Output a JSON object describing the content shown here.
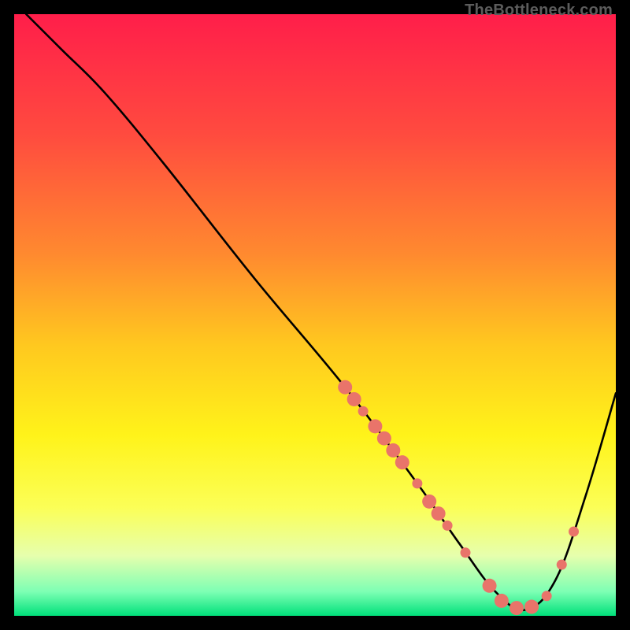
{
  "watermark": "TheBottleneck.com",
  "chart_data": {
    "type": "line",
    "title": "",
    "xlabel": "",
    "ylabel": "",
    "xlim": [
      0,
      100
    ],
    "ylim": [
      0,
      100
    ],
    "grid": false,
    "legend": false,
    "background_gradient": {
      "stops": [
        {
          "pos": 0.0,
          "color": "#ff1e4a"
        },
        {
          "pos": 0.2,
          "color": "#ff4b3f"
        },
        {
          "pos": 0.4,
          "color": "#ff8a2f"
        },
        {
          "pos": 0.55,
          "color": "#ffc81f"
        },
        {
          "pos": 0.7,
          "color": "#fff31a"
        },
        {
          "pos": 0.82,
          "color": "#fbff57"
        },
        {
          "pos": 0.9,
          "color": "#e6ffad"
        },
        {
          "pos": 0.96,
          "color": "#7dffb4"
        },
        {
          "pos": 1.0,
          "color": "#00e07a"
        }
      ]
    },
    "series": [
      {
        "name": "bottleneck-curve",
        "color": "#000000",
        "stroke_width": 2.6,
        "x": [
          2,
          8,
          15,
          25,
          40,
          55,
          67,
          74,
          80,
          85,
          90,
          95,
          100
        ],
        "y": [
          100,
          94,
          87,
          75,
          56,
          38,
          22,
          12,
          4,
          1,
          6,
          20,
          37
        ]
      }
    ],
    "scatter_points": {
      "color": "#e9746a",
      "radius_small": 6.5,
      "radius_big": 9,
      "points": [
        {
          "x": 55.0,
          "y": 38.0,
          "r": "big"
        },
        {
          "x": 56.5,
          "y": 36.0,
          "r": "big"
        },
        {
          "x": 58.0,
          "y": 34.0,
          "r": "small"
        },
        {
          "x": 60.0,
          "y": 31.5,
          "r": "big"
        },
        {
          "x": 61.5,
          "y": 29.5,
          "r": "big"
        },
        {
          "x": 63.0,
          "y": 27.5,
          "r": "big"
        },
        {
          "x": 64.5,
          "y": 25.5,
          "r": "big"
        },
        {
          "x": 67.0,
          "y": 22.0,
          "r": "small"
        },
        {
          "x": 69.0,
          "y": 19.0,
          "r": "big"
        },
        {
          "x": 70.5,
          "y": 17.0,
          "r": "big"
        },
        {
          "x": 72.0,
          "y": 15.0,
          "r": "small"
        },
        {
          "x": 75.0,
          "y": 10.5,
          "r": "small"
        },
        {
          "x": 79.0,
          "y": 5.0,
          "r": "big"
        },
        {
          "x": 81.0,
          "y": 2.5,
          "r": "big"
        },
        {
          "x": 83.5,
          "y": 1.3,
          "r": "big"
        },
        {
          "x": 86.0,
          "y": 1.5,
          "r": "big"
        },
        {
          "x": 88.5,
          "y": 3.3,
          "r": "small"
        },
        {
          "x": 91.0,
          "y": 8.5,
          "r": "small"
        },
        {
          "x": 93.0,
          "y": 14.0,
          "r": "small"
        }
      ]
    }
  }
}
